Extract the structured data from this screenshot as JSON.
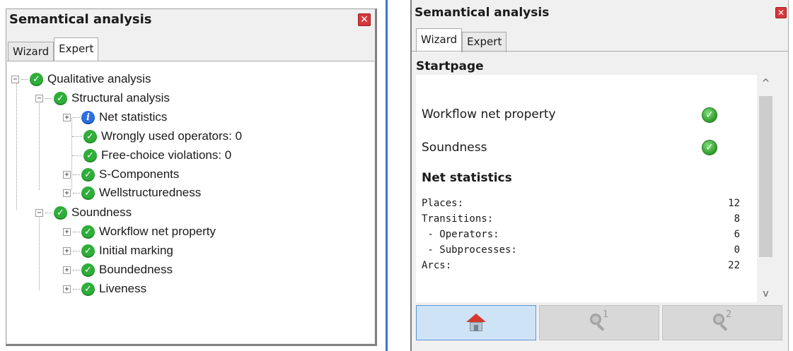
{
  "left": {
    "title": "Semantical analysis",
    "close_glyph": "✕",
    "tabs": [
      {
        "label": "Wizard",
        "active": false
      },
      {
        "label": "Expert",
        "active": true
      }
    ],
    "tree": {
      "root": {
        "label": "Qualitative analysis",
        "icon": "check-icon"
      },
      "structural": {
        "label": "Structural analysis",
        "icon": "check-icon"
      },
      "net_statistics": {
        "label": "Net statistics",
        "icon": "info-icon"
      },
      "wrong_ops": {
        "label": "Wrongly used operators: 0",
        "icon": "check-icon"
      },
      "free_choice": {
        "label": "Free-choice violations: 0",
        "icon": "check-icon"
      },
      "s_components": {
        "label": "S-Components",
        "icon": "check-icon"
      },
      "wellstructuredness": {
        "label": "Wellstructuredness",
        "icon": "check-icon"
      },
      "soundness": {
        "label": "Soundness",
        "icon": "check-icon"
      },
      "workflow_net": {
        "label": "Workflow net property",
        "icon": "check-icon"
      },
      "initial_marking": {
        "label": "Initial marking",
        "icon": "check-icon"
      },
      "boundedness": {
        "label": "Boundedness",
        "icon": "check-icon"
      },
      "liveness": {
        "label": "Liveness",
        "icon": "check-icon"
      }
    }
  },
  "right": {
    "title": "Semantical analysis",
    "close_glyph": "✕",
    "tabs": [
      {
        "label": "Wizard",
        "active": true
      },
      {
        "label": "Expert",
        "active": false
      }
    ],
    "page_title": "Startpage",
    "properties": [
      {
        "label": "Workflow net property",
        "status": "ok"
      },
      {
        "label": "Soundness",
        "status": "ok"
      }
    ],
    "net_statistics": {
      "title": "Net statistics",
      "rows": [
        {
          "label": "Places:",
          "value": "12"
        },
        {
          "label": "Transitions:",
          "value": "8"
        },
        {
          "label": " - Operators:",
          "value": "6"
        },
        {
          "label": " - Subprocesses:",
          "value": "0"
        },
        {
          "label": "Arcs:",
          "value": "22"
        }
      ]
    },
    "scroll": {
      "up": "^",
      "down": "v"
    },
    "nav_buttons": [
      {
        "name": "home",
        "icon": "home-icon"
      },
      {
        "name": "search-1",
        "icon": "magnifier-icon",
        "badge": "1"
      },
      {
        "name": "search-2",
        "icon": "magnifier-icon",
        "badge": "2"
      }
    ]
  },
  "colors": {
    "ok_green": "#2fae3a",
    "info_blue": "#2c6fe0",
    "close_red": "#d8363a",
    "home_button_bg": "#cfe3f6",
    "divider_blue": "#3a78c4"
  }
}
